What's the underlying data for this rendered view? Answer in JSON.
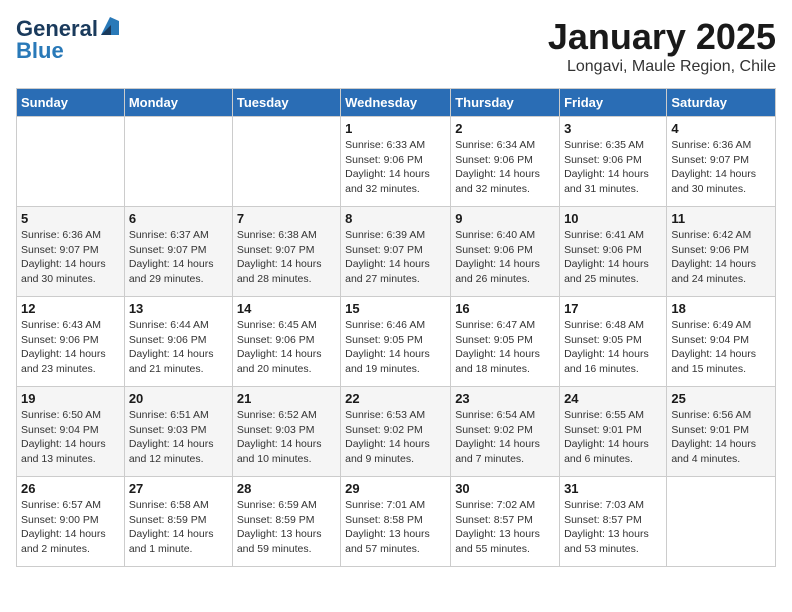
{
  "header": {
    "logo_general": "General",
    "logo_blue": "Blue",
    "title": "January 2025",
    "subtitle": "Longavi, Maule Region, Chile"
  },
  "weekdays": [
    "Sunday",
    "Monday",
    "Tuesday",
    "Wednesday",
    "Thursday",
    "Friday",
    "Saturday"
  ],
  "weeks": [
    [
      {
        "day": "",
        "info": ""
      },
      {
        "day": "",
        "info": ""
      },
      {
        "day": "",
        "info": ""
      },
      {
        "day": "1",
        "info": "Sunrise: 6:33 AM\nSunset: 9:06 PM\nDaylight: 14 hours\nand 32 minutes."
      },
      {
        "day": "2",
        "info": "Sunrise: 6:34 AM\nSunset: 9:06 PM\nDaylight: 14 hours\nand 32 minutes."
      },
      {
        "day": "3",
        "info": "Sunrise: 6:35 AM\nSunset: 9:06 PM\nDaylight: 14 hours\nand 31 minutes."
      },
      {
        "day": "4",
        "info": "Sunrise: 6:36 AM\nSunset: 9:07 PM\nDaylight: 14 hours\nand 30 minutes."
      }
    ],
    [
      {
        "day": "5",
        "info": "Sunrise: 6:36 AM\nSunset: 9:07 PM\nDaylight: 14 hours\nand 30 minutes."
      },
      {
        "day": "6",
        "info": "Sunrise: 6:37 AM\nSunset: 9:07 PM\nDaylight: 14 hours\nand 29 minutes."
      },
      {
        "day": "7",
        "info": "Sunrise: 6:38 AM\nSunset: 9:07 PM\nDaylight: 14 hours\nand 28 minutes."
      },
      {
        "day": "8",
        "info": "Sunrise: 6:39 AM\nSunset: 9:07 PM\nDaylight: 14 hours\nand 27 minutes."
      },
      {
        "day": "9",
        "info": "Sunrise: 6:40 AM\nSunset: 9:06 PM\nDaylight: 14 hours\nand 26 minutes."
      },
      {
        "day": "10",
        "info": "Sunrise: 6:41 AM\nSunset: 9:06 PM\nDaylight: 14 hours\nand 25 minutes."
      },
      {
        "day": "11",
        "info": "Sunrise: 6:42 AM\nSunset: 9:06 PM\nDaylight: 14 hours\nand 24 minutes."
      }
    ],
    [
      {
        "day": "12",
        "info": "Sunrise: 6:43 AM\nSunset: 9:06 PM\nDaylight: 14 hours\nand 23 minutes."
      },
      {
        "day": "13",
        "info": "Sunrise: 6:44 AM\nSunset: 9:06 PM\nDaylight: 14 hours\nand 21 minutes."
      },
      {
        "day": "14",
        "info": "Sunrise: 6:45 AM\nSunset: 9:06 PM\nDaylight: 14 hours\nand 20 minutes."
      },
      {
        "day": "15",
        "info": "Sunrise: 6:46 AM\nSunset: 9:05 PM\nDaylight: 14 hours\nand 19 minutes."
      },
      {
        "day": "16",
        "info": "Sunrise: 6:47 AM\nSunset: 9:05 PM\nDaylight: 14 hours\nand 18 minutes."
      },
      {
        "day": "17",
        "info": "Sunrise: 6:48 AM\nSunset: 9:05 PM\nDaylight: 14 hours\nand 16 minutes."
      },
      {
        "day": "18",
        "info": "Sunrise: 6:49 AM\nSunset: 9:04 PM\nDaylight: 14 hours\nand 15 minutes."
      }
    ],
    [
      {
        "day": "19",
        "info": "Sunrise: 6:50 AM\nSunset: 9:04 PM\nDaylight: 14 hours\nand 13 minutes."
      },
      {
        "day": "20",
        "info": "Sunrise: 6:51 AM\nSunset: 9:03 PM\nDaylight: 14 hours\nand 12 minutes."
      },
      {
        "day": "21",
        "info": "Sunrise: 6:52 AM\nSunset: 9:03 PM\nDaylight: 14 hours\nand 10 minutes."
      },
      {
        "day": "22",
        "info": "Sunrise: 6:53 AM\nSunset: 9:02 PM\nDaylight: 14 hours\nand 9 minutes."
      },
      {
        "day": "23",
        "info": "Sunrise: 6:54 AM\nSunset: 9:02 PM\nDaylight: 14 hours\nand 7 minutes."
      },
      {
        "day": "24",
        "info": "Sunrise: 6:55 AM\nSunset: 9:01 PM\nDaylight: 14 hours\nand 6 minutes."
      },
      {
        "day": "25",
        "info": "Sunrise: 6:56 AM\nSunset: 9:01 PM\nDaylight: 14 hours\nand 4 minutes."
      }
    ],
    [
      {
        "day": "26",
        "info": "Sunrise: 6:57 AM\nSunset: 9:00 PM\nDaylight: 14 hours\nand 2 minutes."
      },
      {
        "day": "27",
        "info": "Sunrise: 6:58 AM\nSunset: 8:59 PM\nDaylight: 14 hours\nand 1 minute."
      },
      {
        "day": "28",
        "info": "Sunrise: 6:59 AM\nSunset: 8:59 PM\nDaylight: 13 hours\nand 59 minutes."
      },
      {
        "day": "29",
        "info": "Sunrise: 7:01 AM\nSunset: 8:58 PM\nDaylight: 13 hours\nand 57 minutes."
      },
      {
        "day": "30",
        "info": "Sunrise: 7:02 AM\nSunset: 8:57 PM\nDaylight: 13 hours\nand 55 minutes."
      },
      {
        "day": "31",
        "info": "Sunrise: 7:03 AM\nSunset: 8:57 PM\nDaylight: 13 hours\nand 53 minutes."
      },
      {
        "day": "",
        "info": ""
      }
    ]
  ]
}
